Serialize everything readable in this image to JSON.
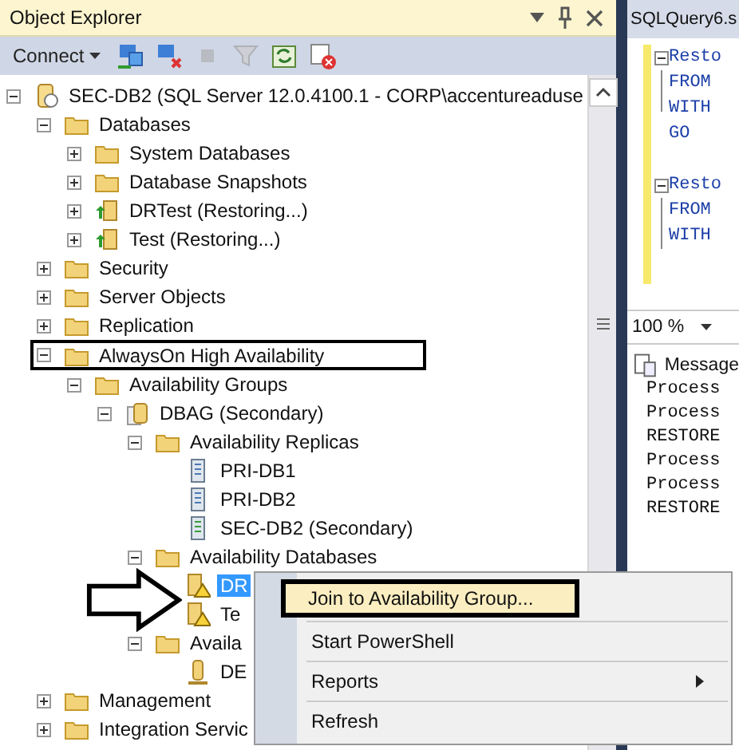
{
  "object_explorer": {
    "title": "Object Explorer",
    "toolbar": {
      "connect": "Connect",
      "buttons": [
        {
          "kind": "connect",
          "disabled": false
        },
        {
          "kind": "disconnect",
          "disabled": false
        },
        {
          "kind": "stop",
          "disabled": true
        },
        {
          "kind": "filter",
          "disabled": true
        },
        {
          "kind": "refresh",
          "disabled": false
        },
        {
          "kind": "activity",
          "disabled": false
        }
      ]
    },
    "tree": [
      {
        "label": "SEC-DB2 (SQL Server 12.0.4100.1 - CORP\\accentureaduse",
        "kind": "server",
        "expanded": true,
        "selected": false,
        "children": [
          {
            "label": "Databases",
            "kind": "folder",
            "expanded": true,
            "selected": false,
            "children": [
              {
                "label": "System Databases",
                "kind": "folder",
                "expanded": false,
                "selected": false,
                "outlined": false
              },
              {
                "label": "Database Snapshots",
                "kind": "folder",
                "expanded": false,
                "selected": false,
                "outlined": false
              },
              {
                "label": "DRTest (Restoring...)",
                "kind": "db-restoring",
                "expanded": false,
                "selected": false,
                "outlined": false
              },
              {
                "label": "Test (Restoring...)",
                "kind": "db-restoring",
                "expanded": false,
                "selected": false,
                "outlined": false
              }
            ]
          },
          {
            "label": "Security",
            "kind": "folder",
            "expanded": false,
            "selected": false,
            "outlined": false
          },
          {
            "label": "Server Objects",
            "kind": "folder",
            "expanded": false,
            "selected": false,
            "outlined": false
          },
          {
            "label": "Replication",
            "kind": "folder",
            "expanded": false,
            "selected": false,
            "outlined": false
          },
          {
            "label": "AlwaysOn High Availability",
            "kind": "folder",
            "expanded": true,
            "selected": false,
            "outlined": true,
            "children": [
              {
                "label": "Availability Groups",
                "kind": "folder",
                "expanded": true,
                "selected": false,
                "children": [
                  {
                    "label": "DBAG (Secondary)",
                    "kind": "ag",
                    "expanded": true,
                    "selected": false,
                    "children": [
                      {
                        "label": "Availability Replicas",
                        "kind": "folder",
                        "expanded": true,
                        "selected": false,
                        "children": [
                          {
                            "label": "PRI-DB1",
                            "kind": "replica",
                            "selected": false,
                            "outlined": false
                          },
                          {
                            "label": "PRI-DB2",
                            "kind": "replica",
                            "selected": false,
                            "outlined": false
                          },
                          {
                            "label": "SEC-DB2 (Secondary)",
                            "kind": "replica-sync",
                            "selected": false,
                            "outlined": false
                          }
                        ]
                      },
                      {
                        "label": "Availability Databases",
                        "kind": "folder",
                        "expanded": true,
                        "selected": false,
                        "children": [
                          {
                            "label": "DR",
                            "kind": "db-warning",
                            "selected": true,
                            "outlined": false
                          },
                          {
                            "label": "Te",
                            "kind": "db-warning",
                            "selected": false,
                            "outlined": false
                          }
                        ]
                      },
                      {
                        "label": "Availa",
                        "kind": "folder",
                        "expanded": true,
                        "selected": false,
                        "children": [
                          {
                            "label": "DE",
                            "kind": "listener",
                            "selected": false,
                            "outlined": false
                          }
                        ]
                      }
                    ]
                  }
                ]
              }
            ]
          },
          {
            "label": "Management",
            "kind": "folder",
            "expanded": false,
            "selected": false,
            "outlined": false
          },
          {
            "label": "Integration Servic",
            "kind": "folder",
            "expanded": false,
            "selected": false,
            "outlined": false
          }
        ]
      }
    ]
  },
  "context_menu": [
    {
      "label": "Join to Availability Group...",
      "kind": "item",
      "selected": true,
      "outlined": true
    },
    {
      "label": "Start PowerShell",
      "kind": "item",
      "selected": false,
      "outlined": false
    },
    {
      "label": "Reports",
      "kind": "submenu",
      "selected": false,
      "outlined": false
    },
    {
      "label": "Refresh",
      "kind": "item",
      "selected": false,
      "outlined": false
    }
  ],
  "query_tab": {
    "title": "SQLQuery6.s",
    "code_lines": [
      {
        "text": "Resto",
        "kind": "fold"
      },
      {
        "text": "FROM",
        "kind": "line"
      },
      {
        "text": "WITH",
        "kind": "end"
      },
      {
        "text": "GO",
        "kind": "plain"
      },
      {
        "kind": "plain"
      },
      {
        "text": "Resto",
        "kind": "fold"
      },
      {
        "text": "FROM",
        "kind": "line"
      },
      {
        "text": "WITH",
        "kind": "line"
      }
    ],
    "zoom": "100 %",
    "messages_tab": "Message",
    "messages": [
      "Process",
      "Process",
      "RESTORE",
      "Process",
      "Process",
      "RESTORE"
    ]
  }
}
